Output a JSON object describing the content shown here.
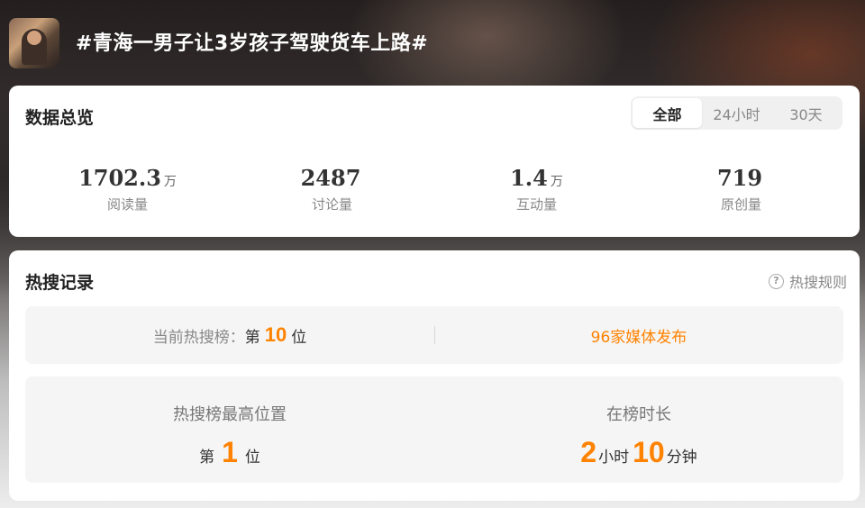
{
  "header": {
    "title": "#青海一男子让3岁孩子驾驶货车上路#"
  },
  "overview": {
    "title": "数据总览",
    "tabs": [
      {
        "label": "全部",
        "active": true
      },
      {
        "label": "24小时",
        "active": false
      },
      {
        "label": "30天",
        "active": false
      }
    ],
    "stats": [
      {
        "value": "1702.3",
        "unit": "万",
        "label": "阅读量"
      },
      {
        "value": "2487",
        "unit": "",
        "label": "讨论量"
      },
      {
        "value": "1.4",
        "unit": "万",
        "label": "互动量"
      },
      {
        "value": "719",
        "unit": "",
        "label": "原创量"
      }
    ]
  },
  "records": {
    "title": "热搜记录",
    "rules_label": "热搜规则",
    "current": {
      "prefix": "当前热搜榜：",
      "rank_prefix": "第",
      "rank": "10",
      "rank_suffix": "位"
    },
    "media": "96家媒体发布",
    "highest": {
      "heading": "热搜榜最高位置",
      "prefix": "第",
      "rank": "1",
      "suffix": "位"
    },
    "duration": {
      "heading": "在榜时长",
      "hours": "2",
      "hours_unit": "小时",
      "minutes": "10",
      "minutes_unit": "分钟"
    }
  },
  "colors": {
    "accent": "#ff8200"
  }
}
